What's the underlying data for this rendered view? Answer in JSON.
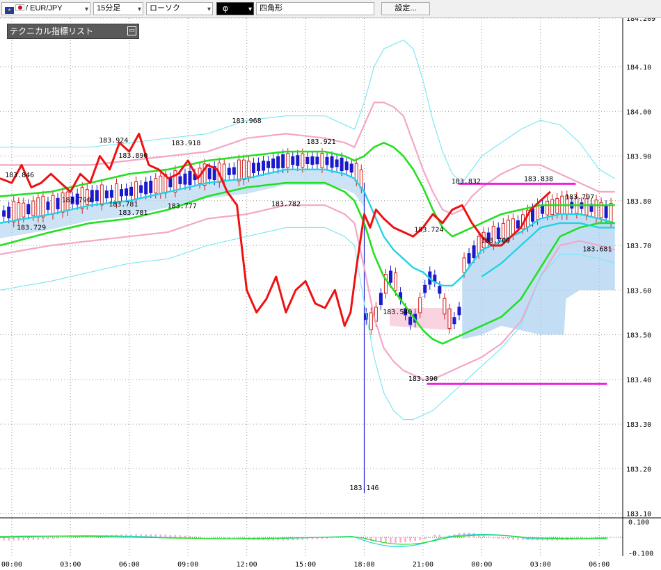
{
  "toolbar": {
    "symbol": "/ EUR/JPY",
    "timeframe": "15分足",
    "chart_style": "ローソク",
    "tool_icon": "φ",
    "shape": "四角形",
    "settings": "設定..."
  },
  "indicator_panel": {
    "title": "テクニカル指標リスト",
    "close_icon": "collapse-icon"
  },
  "colors": {
    "bb_outer": "#7fe7f5",
    "bb_inner": "#f4a6c8",
    "mid_cyan": "#22d3e3",
    "green": "#22e022",
    "red": "#ee1111",
    "magenta": "#ee22dd",
    "bull": "#d0201d",
    "bear": "#1a1acc",
    "cloud": "#aad0f0",
    "cloud_pink": "#f8c8d8"
  },
  "chart_data": {
    "type": "line",
    "title": "",
    "ylim": [
      183.09,
      184.209
    ],
    "y_ticks": [
      "184.209",
      "184.10",
      "184.00",
      "183.90",
      "183.80",
      "183.70",
      "183.60",
      "183.50",
      "183.40",
      "183.30",
      "183.20",
      "183.10"
    ],
    "x_ticks": [
      "00:00",
      "03:00",
      "06:00",
      "09:00",
      "12:00",
      "15:00",
      "18:00",
      "21:00",
      "00:00",
      "03:00",
      "06:00"
    ],
    "x_hours": [
      0,
      3,
      6,
      9,
      12,
      15,
      18,
      21,
      24,
      27,
      30
    ],
    "x_range": [
      -0.6,
      31.2
    ],
    "price_labels": [
      {
        "text": "183.846",
        "x": 0.4,
        "y": 183.846
      },
      {
        "text": "183.729",
        "x": 1.0,
        "y": 183.729
      },
      {
        "text": "183.790",
        "x": 3.3,
        "y": 183.79
      },
      {
        "text": "183.924",
        "x": 5.2,
        "y": 183.924
      },
      {
        "text": "183.890",
        "x": 6.2,
        "y": 183.89
      },
      {
        "text": "183.781",
        "x": 5.7,
        "y": 183.781
      },
      {
        "text": "183.781",
        "x": 6.2,
        "y": 183.762
      },
      {
        "text": "183.918",
        "x": 8.9,
        "y": 183.918
      },
      {
        "text": "183.777",
        "x": 8.7,
        "y": 183.777
      },
      {
        "text": "183.968",
        "x": 12.0,
        "y": 183.968
      },
      {
        "text": "183.921",
        "x": 15.8,
        "y": 183.921
      },
      {
        "text": "183.782",
        "x": 14.0,
        "y": 183.782
      },
      {
        "text": "183.540",
        "x": 19.7,
        "y": 183.54
      },
      {
        "text": "183.146",
        "x": 18.0,
        "y": 183.146
      },
      {
        "text": "183.724",
        "x": 21.3,
        "y": 183.724
      },
      {
        "text": "183.390",
        "x": 21.0,
        "y": 183.39
      },
      {
        "text": "183.832",
        "x": 23.2,
        "y": 183.832
      },
      {
        "text": "183.700",
        "x": 24.7,
        "y": 183.7
      },
      {
        "text": "183.838",
        "x": 26.9,
        "y": 183.838
      },
      {
        "text": "183.797",
        "x": 29.0,
        "y": 183.797
      },
      {
        "text": "183.681",
        "x": 29.9,
        "y": 183.681
      }
    ],
    "series": [
      {
        "role": "bb_outer_upper",
        "color": "#7fe7f5",
        "x": [
          -0.6,
          2,
          4,
          6,
          8,
          10,
          12,
          14,
          16,
          17,
          17.5,
          18,
          18.5,
          19,
          19.5,
          20,
          20.5,
          21,
          21.5,
          22,
          22.5,
          23,
          23.5,
          24,
          25,
          26,
          27,
          28,
          29,
          30,
          30.8
        ],
        "y": [
          183.92,
          183.92,
          183.92,
          183.93,
          183.94,
          183.95,
          183.98,
          183.99,
          183.99,
          183.97,
          183.96,
          184.02,
          184.1,
          184.14,
          184.15,
          184.16,
          184.14,
          184.07,
          183.98,
          183.91,
          183.86,
          183.84,
          183.87,
          183.9,
          183.93,
          183.96,
          183.98,
          183.97,
          183.93,
          183.87,
          183.85
        ]
      },
      {
        "role": "bb_inner_upper",
        "color": "#f4a6c8",
        "x": [
          -0.6,
          2,
          4,
          6,
          8,
          10,
          12,
          14,
          16,
          17,
          17.5,
          18,
          18.5,
          19,
          19.5,
          20,
          20.5,
          21,
          21.5,
          22,
          22.5,
          23,
          23.5,
          24,
          25,
          26,
          27,
          28,
          29,
          30,
          30.8
        ],
        "y": [
          183.88,
          183.88,
          183.88,
          183.89,
          183.9,
          183.91,
          183.94,
          183.95,
          183.94,
          183.93,
          183.92,
          183.97,
          184.02,
          184.02,
          184.01,
          183.99,
          183.93,
          183.87,
          183.82,
          183.78,
          183.77,
          183.78,
          183.81,
          183.83,
          183.86,
          183.88,
          183.88,
          183.86,
          183.84,
          183.82,
          183.82
        ]
      },
      {
        "role": "cyan_mid",
        "color": "#22d3e3",
        "x": [
          -0.6,
          2,
          4,
          6,
          8,
          10,
          12,
          14,
          15,
          16,
          17,
          17.5,
          18,
          18.5,
          19,
          19.5,
          20,
          20.5,
          21,
          21.5,
          22,
          22.5,
          23,
          23.5,
          24,
          25,
          26,
          27,
          28,
          29,
          30,
          30.8
        ],
        "y": [
          183.75,
          183.77,
          183.79,
          183.8,
          183.82,
          183.84,
          183.85,
          183.87,
          183.87,
          183.87,
          183.86,
          183.85,
          183.82,
          183.77,
          183.72,
          183.69,
          183.67,
          183.65,
          183.64,
          183.62,
          183.61,
          183.61,
          183.63,
          183.66,
          183.69,
          183.71,
          183.73,
          183.76,
          183.77,
          183.77,
          183.76,
          183.75
        ]
      },
      {
        "role": "green_slow",
        "color": "#22e022",
        "x": [
          -0.6,
          2,
          4,
          6,
          8,
          10,
          12,
          14,
          16,
          17,
          17.5,
          18,
          18.5,
          19,
          19.5,
          20,
          20.5,
          21,
          21.5,
          22,
          22.5,
          23,
          23.5,
          24,
          25,
          26,
          27,
          28,
          29,
          30,
          30.8
        ],
        "y": [
          183.81,
          183.82,
          183.84,
          183.86,
          183.87,
          183.89,
          183.9,
          183.91,
          183.91,
          183.9,
          183.89,
          183.9,
          183.92,
          183.93,
          183.92,
          183.9,
          183.87,
          183.83,
          183.78,
          183.74,
          183.72,
          183.73,
          183.74,
          183.75,
          183.77,
          183.78,
          183.79,
          183.79,
          183.79,
          183.79,
          183.79
        ]
      },
      {
        "role": "green_fast",
        "color": "#22e022",
        "x": [
          -0.6,
          2,
          4,
          6,
          8,
          10,
          12,
          14,
          16,
          17,
          17.5,
          18,
          18.5,
          19,
          19.5,
          20,
          20.5,
          21,
          21.5,
          22,
          22.5,
          23,
          23.5,
          24,
          25,
          26,
          27,
          28,
          29,
          30,
          30.8
        ],
        "y": [
          183.7,
          183.73,
          183.75,
          183.76,
          183.78,
          183.81,
          183.83,
          183.84,
          183.84,
          183.82,
          183.8,
          183.75,
          183.68,
          183.63,
          183.6,
          183.57,
          183.54,
          183.51,
          183.49,
          183.48,
          183.49,
          183.5,
          183.51,
          183.52,
          183.54,
          183.58,
          183.65,
          183.72,
          183.74,
          183.75,
          183.75
        ]
      },
      {
        "role": "cyan_lower",
        "color": "#22d3e3",
        "x": [
          24,
          25,
          26,
          27,
          28,
          29,
          30,
          30.8
        ],
        "y": [
          183.63,
          183.66,
          183.7,
          183.74,
          183.75,
          183.75,
          183.74,
          183.74
        ]
      },
      {
        "role": "bb_inner_lower",
        "color": "#f4a6c8",
        "x": [
          -0.6,
          2,
          4,
          6,
          8,
          10,
          12,
          14,
          16,
          17,
          17.5,
          18,
          18.5,
          19,
          19.5,
          20,
          20.5,
          21,
          21.5,
          22,
          22.5,
          23,
          23.5,
          24,
          25,
          26,
          27,
          28,
          29,
          30,
          30.8
        ],
        "y": [
          183.68,
          183.7,
          183.71,
          183.72,
          183.73,
          183.76,
          183.77,
          183.79,
          183.79,
          183.77,
          183.75,
          183.65,
          183.54,
          183.47,
          183.44,
          183.42,
          183.41,
          183.4,
          183.4,
          183.41,
          183.42,
          183.43,
          183.44,
          183.45,
          183.48,
          183.53,
          183.63,
          183.7,
          183.71,
          183.7,
          183.69
        ]
      },
      {
        "role": "bb_outer_lower",
        "color": "#7fe7f5",
        "x": [
          -0.6,
          2,
          4,
          6,
          8,
          10,
          12,
          14,
          16,
          17,
          17.5,
          18,
          18.5,
          19,
          19.5,
          20,
          20.5,
          21,
          21.5,
          22,
          22.5,
          23,
          23.5,
          24,
          25,
          26,
          27,
          28,
          29,
          30,
          30.8
        ],
        "y": [
          183.6,
          183.62,
          183.64,
          183.66,
          183.67,
          183.7,
          183.72,
          183.74,
          183.74,
          183.72,
          183.7,
          183.57,
          183.45,
          183.37,
          183.33,
          183.31,
          183.31,
          183.32,
          183.33,
          183.35,
          183.37,
          183.39,
          183.41,
          183.43,
          183.47,
          183.52,
          183.63,
          183.68,
          183.68,
          183.67,
          183.66
        ]
      },
      {
        "role": "red_line",
        "color": "#ee1111",
        "x": [
          -0.6,
          0,
          0.5,
          1,
          1.5,
          2,
          2.5,
          3,
          3.5,
          4,
          4.5,
          5,
          5.5,
          6,
          6.5,
          7,
          7.5,
          8,
          8.5,
          9,
          9.5,
          10,
          10.5,
          11,
          11.5,
          12,
          12.5,
          13,
          13.5,
          14,
          14.5,
          15,
          15.5,
          16,
          16.5,
          17,
          17.3,
          17.6,
          18,
          18.3,
          18.6,
          19,
          19.5,
          20,
          20.5,
          21,
          21.5,
          22,
          22.5,
          23,
          23.5,
          24,
          24.5,
          25,
          25.5,
          26,
          26.5,
          27,
          27.5
        ],
        "y": [
          183.85,
          183.84,
          183.88,
          183.83,
          183.84,
          183.86,
          183.84,
          183.82,
          183.86,
          183.84,
          183.9,
          183.87,
          183.93,
          183.91,
          183.95,
          183.88,
          183.87,
          183.85,
          183.86,
          183.89,
          183.85,
          183.88,
          183.87,
          183.82,
          183.79,
          183.6,
          183.55,
          183.58,
          183.63,
          183.55,
          183.6,
          183.62,
          183.57,
          183.56,
          183.6,
          183.52,
          183.55,
          183.65,
          183.77,
          183.74,
          183.78,
          183.76,
          183.74,
          183.73,
          183.72,
          183.74,
          183.77,
          183.75,
          183.78,
          183.79,
          183.75,
          183.72,
          183.7,
          183.7,
          183.72,
          183.74,
          183.78,
          183.8,
          183.82
        ]
      }
    ],
    "levels": [
      {
        "role": "magenta_resistance",
        "color": "#ee22dd",
        "y": 183.838,
        "x_from": 22.8,
        "x_to": 28.8
      },
      {
        "role": "magenta_support",
        "color": "#ee22dd",
        "y": 183.39,
        "x_from": 21.2,
        "x_to": 30.4
      }
    ],
    "sub_panel": {
      "y_ticks": [
        "0.100",
        "-0.100"
      ],
      "ylim": [
        -0.12,
        0.12
      ]
    }
  }
}
